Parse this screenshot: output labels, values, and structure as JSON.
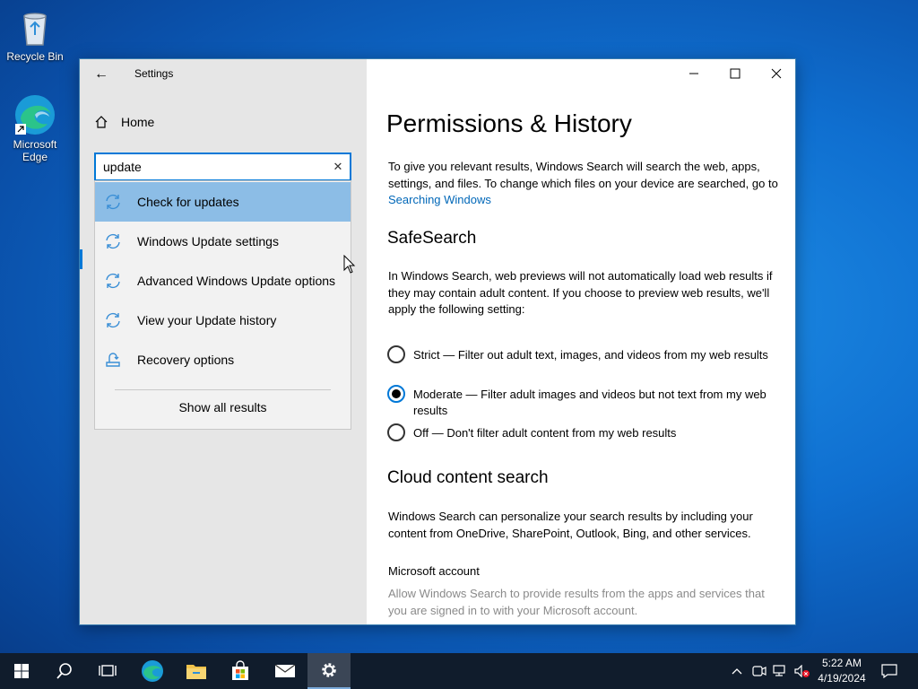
{
  "desktop": {
    "icons": [
      {
        "label": "Recycle Bin",
        "icon": "recycle-bin-icon"
      },
      {
        "label": "Microsoft Edge",
        "icon": "edge-icon"
      }
    ]
  },
  "window": {
    "title": "Settings",
    "controls": {
      "minimize": "minimize-icon",
      "maximize": "maximize-icon",
      "close": "close-icon"
    }
  },
  "nav": {
    "home_label": "Home"
  },
  "search": {
    "value": "update",
    "results": [
      {
        "label": "Check for updates",
        "icon": "sync-icon",
        "selected": true
      },
      {
        "label": "Windows Update settings",
        "icon": "sync-icon",
        "selected": false
      },
      {
        "label": "Advanced Windows Update options",
        "icon": "sync-icon",
        "selected": false
      },
      {
        "label": "View your Update history",
        "icon": "sync-icon",
        "selected": false
      },
      {
        "label": "Recovery options",
        "icon": "recovery-icon",
        "selected": false
      }
    ],
    "show_all_label": "Show all results"
  },
  "content": {
    "title": "Permissions & History",
    "intro": "To give you relevant results, Windows Search will search the web, apps, settings, and files. To change which files on your device are searched, go to",
    "intro_link": "Searching Windows",
    "safesearch": {
      "heading": "SafeSearch",
      "description": "In Windows Search, web previews will not automatically load web results if they may contain adult content. If you choose to preview web results, we'll apply the following setting:",
      "options": [
        {
          "label": "Strict — Filter out adult text, images, and videos from my web results",
          "selected": false
        },
        {
          "label": "Moderate — Filter adult images and videos but not text from my web results",
          "selected": true
        },
        {
          "label": "Off — Don't filter adult content from my web results",
          "selected": false
        }
      ]
    },
    "cloud": {
      "heading": "Cloud content search",
      "description": "Windows Search can personalize your search results by including your content from OneDrive, SharePoint, Outlook, Bing, and other services.",
      "account_heading": "Microsoft account",
      "account_description": "Allow Windows Search to provide results from the apps and services that you are signed in to with your Microsoft account."
    }
  },
  "taskbar": {
    "buttons": [
      "start-icon",
      "search-icon",
      "task-view-icon",
      "edge-icon",
      "file-explorer-icon",
      "store-icon",
      "mail-icon",
      "settings-icon"
    ],
    "active": "settings-icon",
    "clock_time": "5:22 AM",
    "clock_date": "4/19/2024"
  },
  "colors": {
    "accent": "#0078d7",
    "selected_result": "#8cbde6",
    "link": "#0067b8",
    "taskbar": "#101c2c"
  }
}
